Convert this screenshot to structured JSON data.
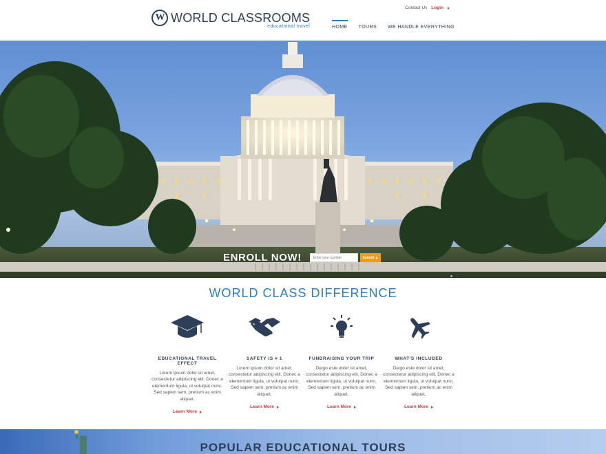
{
  "header": {
    "logo_letter": "W",
    "logo_name": "WORLD CLASSROOMS",
    "logo_tagline": "educational travel",
    "contact_label": "Contact Us",
    "login_label": "Login",
    "nav": [
      {
        "label": "HOME",
        "active": true
      },
      {
        "label": "TOURS",
        "active": false
      },
      {
        "label": "WE HANDLE EVERYTHING",
        "active": false
      }
    ]
  },
  "hero": {
    "enroll_label": "ENROLL NOW!",
    "input_placeholder": "Enter your number",
    "submit_label": "Submit",
    "slides": 2,
    "active_slide": 2
  },
  "difference": {
    "title": "WORLD CLASS DIFFERENCE",
    "features": [
      {
        "icon": "graduation-cap-icon",
        "title": "EDUCATIONAL TRAVEL EFFECT",
        "text": "Lorem ipsum dolor sit amet, consectetur adipiscing elit. Donec a elementum ligula, ut volutpat nunc. Sed sapien sem, pretium ac enim aliquet.",
        "link": "Learn More"
      },
      {
        "icon": "handshake-icon",
        "title": "SAFETY IS # 1",
        "text": "Lorem ipsum dolor sit amet, consectetur adipiscing elit. Donec a elementum ligula, ut volutpat nunc. Sed sapien sem, pretium ac enim aliquet.",
        "link": "Learn More"
      },
      {
        "icon": "lightbulb-icon",
        "title": "FUNDRAISING YOUR TRIP",
        "text": "Deigo este dolor sit amet, consectetur adipiscing elit. Donec a elementum ligula, ut volutpat nunc. Sed sapien sem, pretium ac enim aliquet.",
        "link": "Learn More"
      },
      {
        "icon": "airplane-icon",
        "title": "WHAT'S INCLUDED",
        "text": "Deigo este dolor sit amet, consectetur adipiscing elit. Donec a elementum ligula, ut volutpat nunc. Sed sapien sem, pretium ac enim aliquet.",
        "link": "Learn More"
      }
    ]
  },
  "tours": {
    "title": "POPULAR EDUCATIONAL TOURS"
  },
  "colors": {
    "brand_navy": "#2d3e57",
    "accent_blue": "#2d7fc1",
    "link_red": "#c73a3a",
    "submit_orange": "#f39a1c"
  }
}
